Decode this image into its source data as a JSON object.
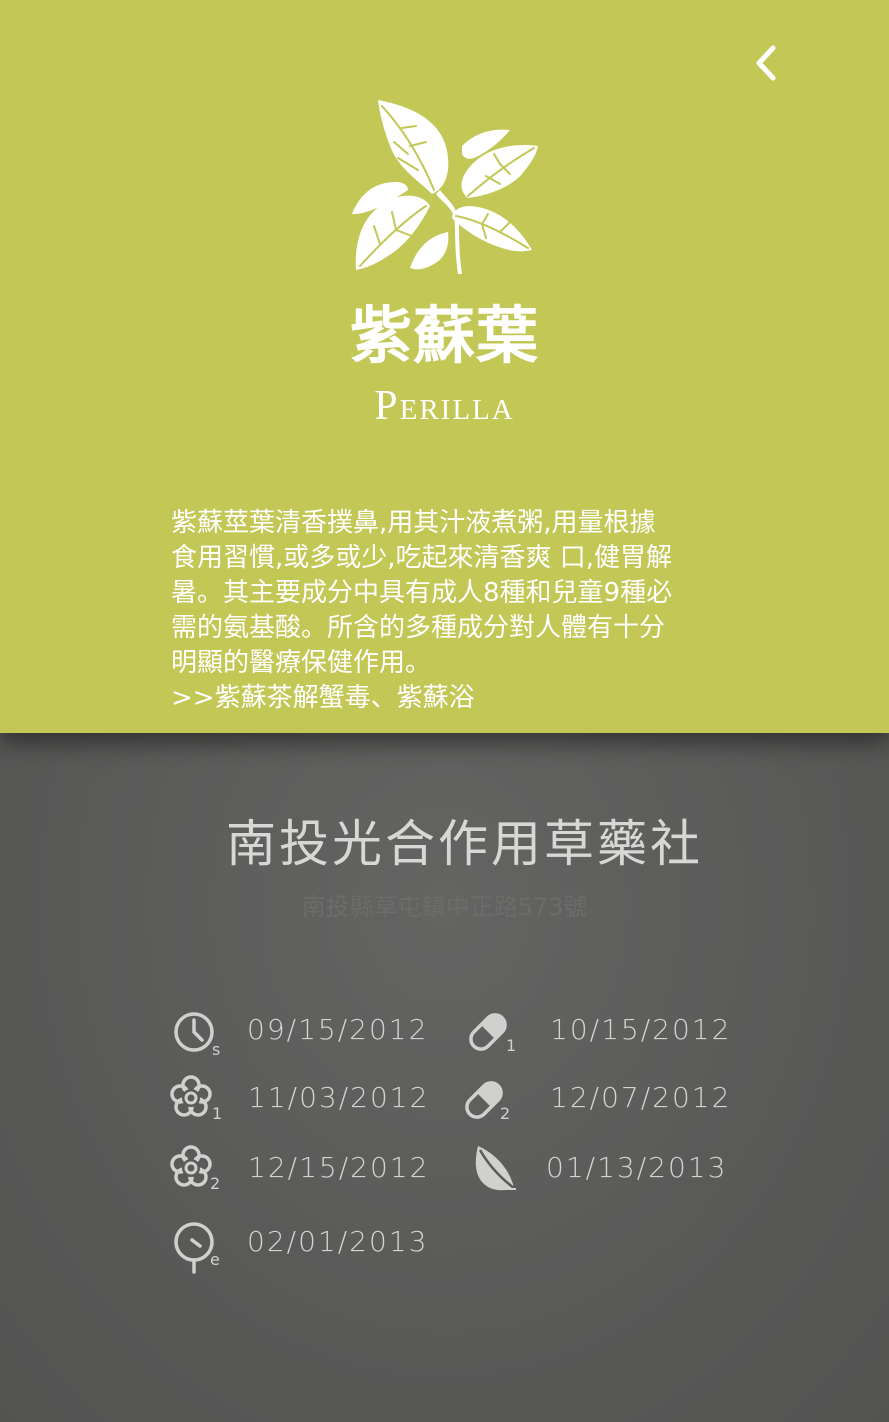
{
  "herb": {
    "name_cn": "紫蘇葉",
    "name_en": "Perilla",
    "description_lines": [
      "紫蘇莖葉清香撲鼻,用其汁液煮粥,用量根據",
      "食用習慣,或多或少,吃起來清香爽 口,健胃解",
      "暑。其主要成分中具有成人8種和兒童9種必",
      "需的氨基酸。所含的多種成分對人體有十分",
      "明顯的醫療保健作用。",
      ">>紫蘇茶解蟹毒、紫蘇浴"
    ]
  },
  "shop": {
    "name": "南投光合作用草藥社",
    "address": "南投縣草屯鎮中正路573號"
  },
  "dates": [
    {
      "icon": "clock-icon",
      "sub": "s",
      "date": "09/15/2012"
    },
    {
      "icon": "capsule-icon",
      "sub": "1",
      "date": "10/15/2012"
    },
    {
      "icon": "flower-icon",
      "sub": "1",
      "date": "11/03/2012"
    },
    {
      "icon": "capsule-icon",
      "sub": "2",
      "date": "12/07/2012"
    },
    {
      "icon": "flower-icon",
      "sub": "2",
      "date": "12/15/2012"
    },
    {
      "icon": "leaf-icon",
      "sub": "",
      "date": "01/13/2013"
    },
    {
      "icon": "clock-end-icon",
      "sub": "e",
      "date": "02/01/2013"
    }
  ],
  "colors": {
    "top_panel": "#c2c756",
    "bottom_panel": "#5a5a59",
    "text_light": "#d3d3d1"
  }
}
